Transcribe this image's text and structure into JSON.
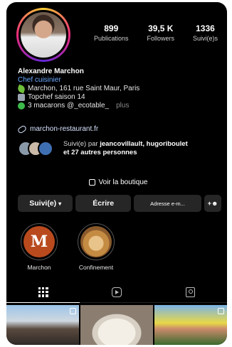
{
  "profile": {
    "stats": [
      {
        "value": "899",
        "label": "Publications"
      },
      {
        "value": "39,5 K",
        "label": "Followers"
      },
      {
        "value": "1336",
        "label": "Suivi(e)s"
      }
    ],
    "name": "Alexandre Marchon",
    "category": "Chef cuisinier",
    "bio_lines": [
      {
        "icon": "leaf-icon",
        "text": "Marchon, 161 rue Saint Maur, Paris"
      },
      {
        "icon": "tv-icon",
        "text": "Topchef saison 14"
      },
      {
        "icon": "ball-icon",
        "text": "3 macarons @_ecotable_"
      }
    ],
    "more_label": "plus",
    "link": "marchon-restaurant.fr",
    "followed_by": {
      "prefix": "Suivi(e) par ",
      "names": "jeancovillault, hugoriboulet",
      "suffix_bold": "et 27 autres personnes"
    }
  },
  "shop_label": "Voir la boutique",
  "actions": {
    "following": "Suivi(e)",
    "message": "Écrire",
    "address": "Adresse e-m...",
    "add_person": "+♀"
  },
  "highlights": [
    {
      "label": "Marchon",
      "letter": "M"
    },
    {
      "label": "Confinement"
    }
  ],
  "tabs": [
    "grid-icon",
    "reels-icon",
    "tagged-icon"
  ],
  "colors": {
    "background": "#000000",
    "link": "#6aa9ff",
    "button": "#262626"
  }
}
